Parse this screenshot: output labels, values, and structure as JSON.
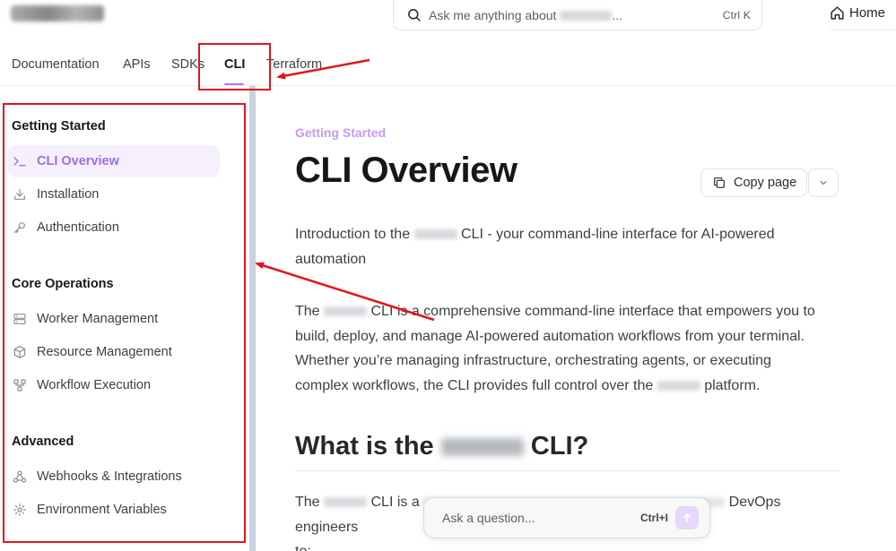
{
  "header": {
    "search_prefix": "Ask me anything about",
    "search_suffix": "...",
    "search_shortcut": "Ctrl K",
    "home_label": "Home"
  },
  "tabs": [
    {
      "label": "Documentation"
    },
    {
      "label": "APIs"
    },
    {
      "label": "SDKs"
    },
    {
      "label": "CLI",
      "active": true
    },
    {
      "label": "Terraform"
    }
  ],
  "sidebar": {
    "sections": [
      {
        "title": "Getting Started",
        "items": [
          {
            "label": "CLI Overview",
            "icon": "terminal-icon",
            "active": true
          },
          {
            "label": "Installation",
            "icon": "download-icon"
          },
          {
            "label": "Authentication",
            "icon": "key-icon"
          }
        ]
      },
      {
        "title": "Core Operations",
        "items": [
          {
            "label": "Worker Management",
            "icon": "server-icon"
          },
          {
            "label": "Resource Management",
            "icon": "cube-icon"
          },
          {
            "label": "Workflow Execution",
            "icon": "workflow-icon"
          }
        ]
      },
      {
        "title": "Advanced",
        "items": [
          {
            "label": "Webhooks & Integrations",
            "icon": "webhook-icon"
          },
          {
            "label": "Environment Variables",
            "icon": "gear-icon"
          }
        ]
      }
    ]
  },
  "main": {
    "eyebrow": "Getting Started",
    "title": "CLI Overview",
    "copy_label": "Copy page",
    "intro_1": "Introduction to the",
    "intro_2": "CLI - your command-line interface for AI-powered",
    "intro_3": "automation",
    "p2_1": "The",
    "p2_2": "CLI is a comprehensive command-line interface that empowers you to",
    "p2_3": "build, deploy, and manage AI-powered automation workflows from your terminal.",
    "p2_4": "Whether you’re managing infrastructure, orchestrating agents, or executing",
    "p2_5": "complex workflows, the CLI provides full control over the",
    "p2_6": "platform.",
    "h2_prefix": "What is the",
    "h2_suffix": "CLI?",
    "p3_1": "The",
    "p3_2": "CLI is a",
    "p3_3": "DevOps engineers",
    "p3_4": "to:"
  },
  "ask": {
    "placeholder": "Ask a question...",
    "shortcut": "Ctrl+I"
  },
  "colors": {
    "accent": "#a67cf0",
    "annotation": "#e0161d"
  }
}
